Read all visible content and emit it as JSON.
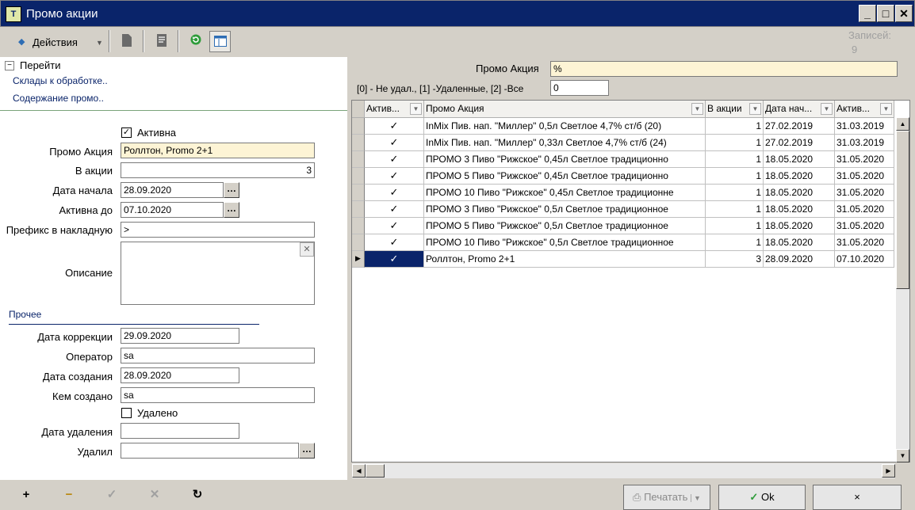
{
  "window": {
    "title": "Промо акции",
    "icon_text": "T"
  },
  "toolbar": {
    "actions_label": "Действия",
    "records_label": "Записей:",
    "records_count": "9"
  },
  "tree": {
    "root_label": "Перейти",
    "links": [
      "Склады к обработке..",
      "Содержание промо.."
    ]
  },
  "form": {
    "active_label": "Активна",
    "promo_label": "Промо Акция",
    "promo_value": "Роллтон,  Promo 2+1",
    "in_promo_label": "В акции",
    "in_promo_value": "3",
    "start_label": "Дата начала",
    "start_value": "28.09.2020",
    "active_until_label": "Активна до",
    "active_until_value": "07.10.2020",
    "prefix_label": "Префикс в накладную",
    "prefix_value": ">",
    "desc_label": "Описание",
    "other_label": "Прочее",
    "corr_date_label": "Дата коррекции",
    "corr_date_value": "29.09.2020",
    "operator_label": "Оператор",
    "operator_value": "sa",
    "created_label": "Дата создания",
    "created_value": "28.09.2020",
    "created_by_label": "Кем создано",
    "created_by_value": "sa",
    "deleted_label": "Удалено",
    "del_date_label": "Дата удаления",
    "del_date_value": "",
    "deleted_by_label": "Удалил",
    "deleted_by_value": ""
  },
  "filter": {
    "promo_label": "Промо Акция",
    "promo_value": "%",
    "deleted_label": "[0] - Не удал., [1] -Удаленные, [2] -Все",
    "deleted_value": "0"
  },
  "grid": {
    "headers": [
      "Актив...",
      "Промо Акция",
      "В акции",
      "Дата нач...",
      "Актив..."
    ],
    "rows": [
      [
        "✓",
        "InMix Пив. нап. \"Миллер\" 0,5л Светлое 4,7% ст/б (20)",
        "1",
        "27.02.2019",
        "31.03.2019"
      ],
      [
        "✓",
        "InMix Пив. нап. \"Миллер\" 0,33л Светлое 4,7% ст/б (24)",
        "1",
        "27.02.2019",
        "31.03.2019"
      ],
      [
        "✓",
        "ПРОМО 3 Пиво \"Рижское\" 0,45л Светлое традиционно",
        "1",
        "18.05.2020",
        "31.05.2020"
      ],
      [
        "✓",
        "ПРОМО 5 Пиво \"Рижское\" 0,45л Светлое традиционно",
        "1",
        "18.05.2020",
        "31.05.2020"
      ],
      [
        "✓",
        "ПРОМО 10 Пиво \"Рижское\" 0,45л Светлое традиционне",
        "1",
        "18.05.2020",
        "31.05.2020"
      ],
      [
        "✓",
        "ПРОМО 3 Пиво \"Рижское\" 0,5л Светлое традиционное",
        "1",
        "18.05.2020",
        "31.05.2020"
      ],
      [
        "✓",
        "ПРОМО 5 Пиво \"Рижское\" 0,5л Светлое традиционное",
        "1",
        "18.05.2020",
        "31.05.2020"
      ],
      [
        "✓",
        "ПРОМО 10 Пиво \"Рижское\" 0,5л Светлое традиционное",
        "1",
        "18.05.2020",
        "31.05.2020"
      ],
      [
        "✓",
        "Роллтон,  Promo 2+1",
        "3",
        "28.09.2020",
        "07.10.2020"
      ]
    ]
  },
  "buttons": {
    "print": "Печатать",
    "ok": "Ok",
    "cancel": "×"
  }
}
